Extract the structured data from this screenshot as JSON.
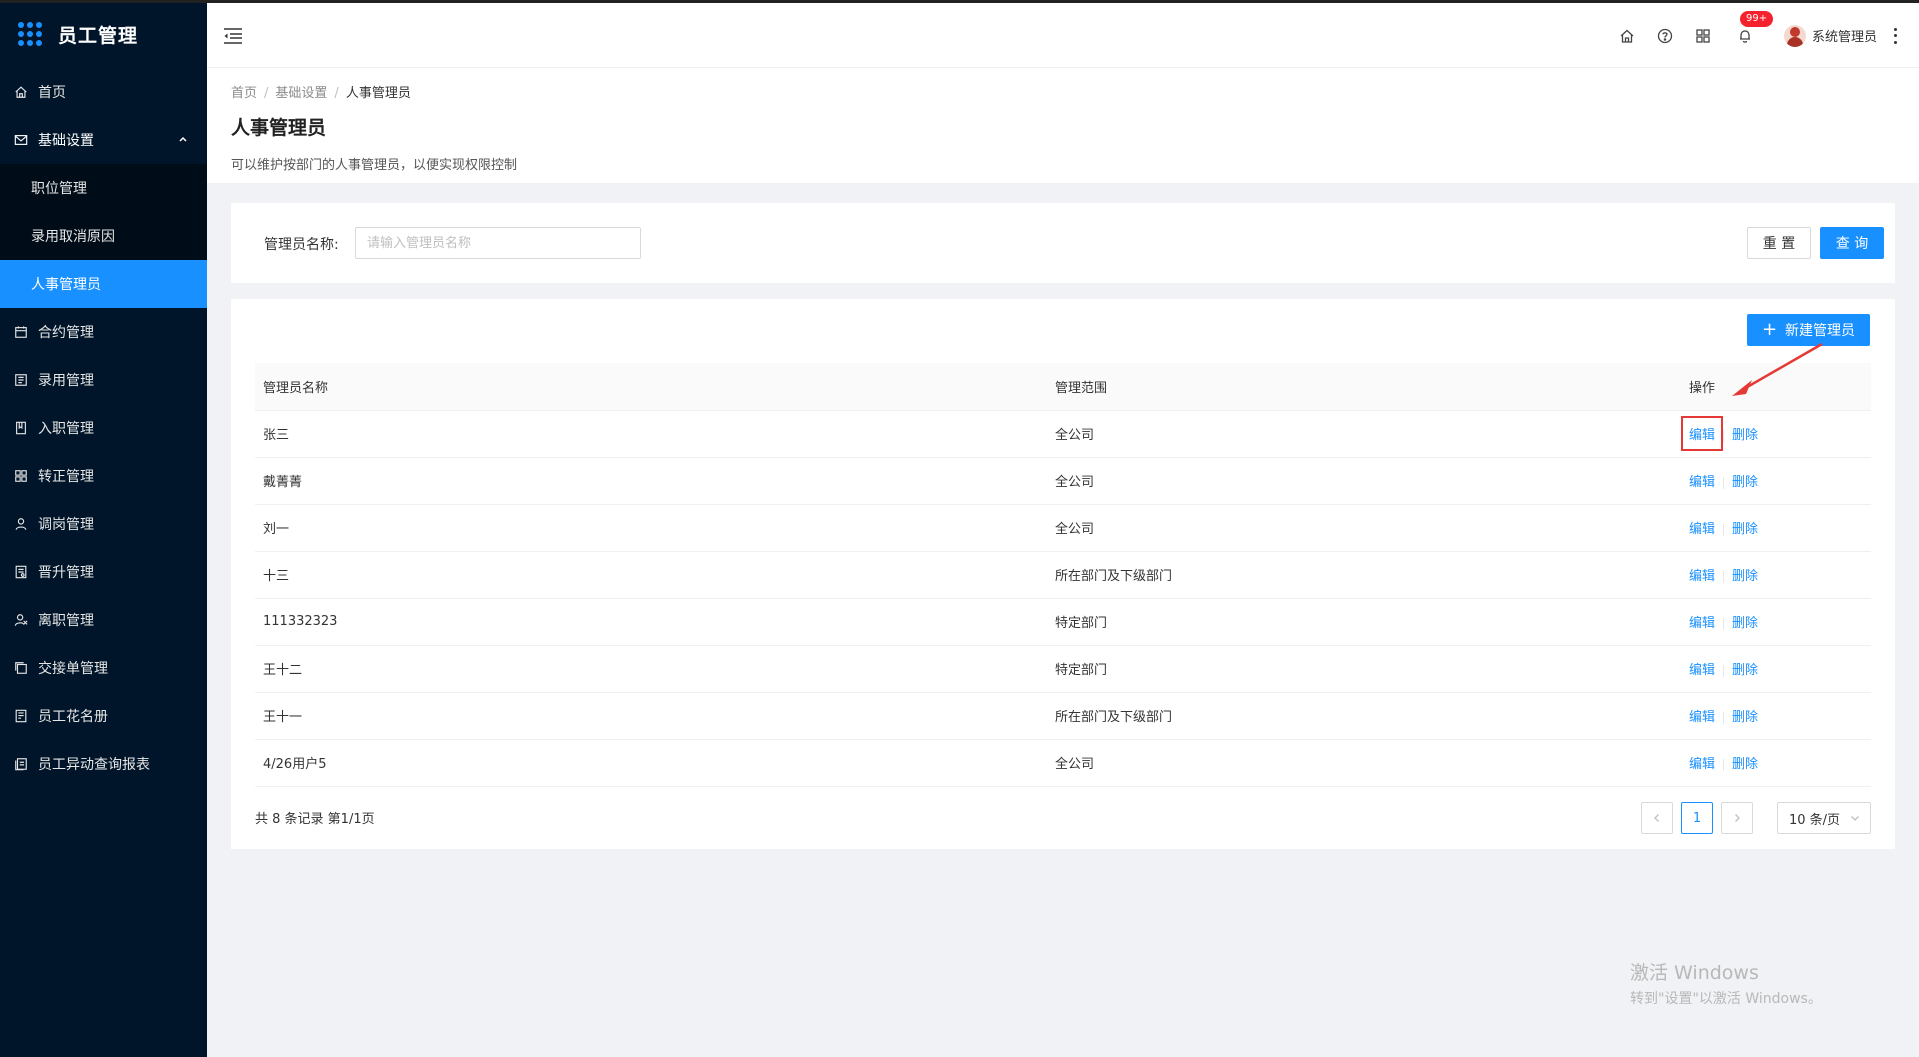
{
  "app": {
    "title": "员工管理"
  },
  "sidebar": {
    "items": [
      {
        "label": "首页",
        "icon": "home-icon"
      },
      {
        "label": "基础设置",
        "icon": "mail-icon",
        "open": true,
        "children": [
          {
            "label": "职位管理"
          },
          {
            "label": "录用取消原因"
          },
          {
            "label": "人事管理员",
            "active": true
          }
        ]
      },
      {
        "label": "合约管理",
        "icon": "calendar-icon"
      },
      {
        "label": "录用管理",
        "icon": "profile-icon"
      },
      {
        "label": "入职管理",
        "icon": "book-icon"
      },
      {
        "label": "转正管理",
        "icon": "apps-icon"
      },
      {
        "label": "调岗管理",
        "icon": "user-icon"
      },
      {
        "label": "晋升管理",
        "icon": "file-icon"
      },
      {
        "label": "离职管理",
        "icon": "user-leave-icon"
      },
      {
        "label": "交接单管理",
        "icon": "copy-icon"
      },
      {
        "label": "员工花名册",
        "icon": "roster-icon"
      },
      {
        "label": "员工异动查询报表",
        "icon": "report-icon"
      }
    ]
  },
  "header": {
    "notification_count": "99+",
    "username": "系统管理员"
  },
  "breadcrumb": [
    "首页",
    "基础设置",
    "人事管理员"
  ],
  "page": {
    "title": "人事管理员",
    "description": "可以维护按部门的人事管理员，以便实现权限控制"
  },
  "search": {
    "label": "管理员名称:",
    "placeholder": "请输入管理员名称",
    "value": "",
    "reset_label": "重 置",
    "query_label": "查 询"
  },
  "table": {
    "new_button_label": "新建管理员",
    "columns": [
      "管理员名称",
      "管理范围",
      "操作"
    ],
    "rows": [
      {
        "name": "张三",
        "scope": "全公司",
        "edit": "编辑",
        "delete": "删除"
      },
      {
        "name": "戴菁菁",
        "scope": "全公司",
        "edit": "编辑",
        "delete": "删除"
      },
      {
        "name": "刘一",
        "scope": "全公司",
        "edit": "编辑",
        "delete": "删除"
      },
      {
        "name": "十三",
        "scope": "所在部门及下级部门",
        "edit": "编辑",
        "delete": "删除"
      },
      {
        "name": "111332323",
        "scope": "特定部门",
        "edit": "编辑",
        "delete": "删除"
      },
      {
        "name": "王十二",
        "scope": "特定部门",
        "edit": "编辑",
        "delete": "删除"
      },
      {
        "name": "王十一",
        "scope": "所在部门及下级部门",
        "edit": "编辑",
        "delete": "删除"
      },
      {
        "name": "4/26用户5",
        "scope": "全公司",
        "edit": "编辑",
        "delete": "删除"
      }
    ],
    "total_text": "共 8 条记录 第1/1页"
  },
  "pagination": {
    "current_page": "1",
    "page_size": "10 条/页"
  },
  "watermark": {
    "line1": "激活 Windows",
    "line2": "转到\"设置\"以激活 Windows。"
  },
  "colors": {
    "sidebar_bg": "#001529",
    "primary": "#1890ff",
    "annotation": "#e53935"
  }
}
